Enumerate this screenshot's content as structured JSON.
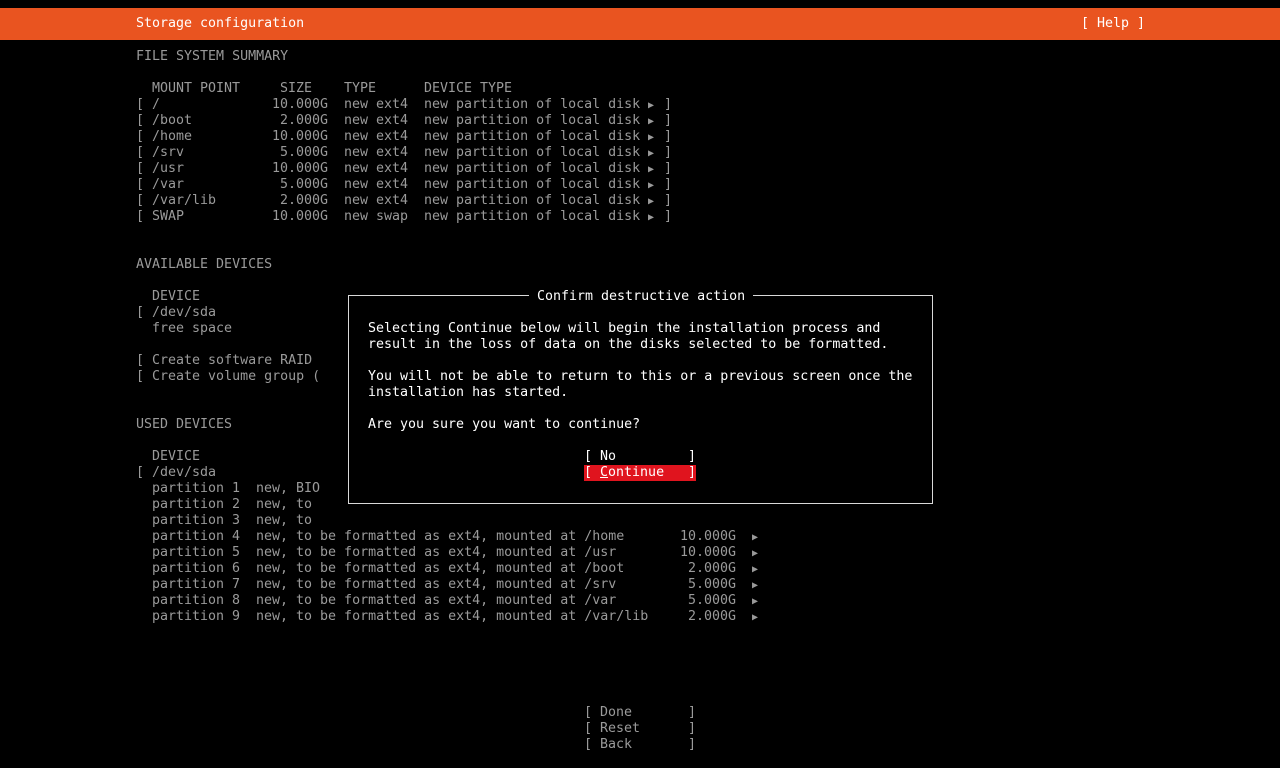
{
  "header": {
    "title": "Storage configuration",
    "help_label": "[ Help ]"
  },
  "summary": {
    "heading": "FILE SYSTEM SUMMARY",
    "columns": {
      "mount": "MOUNT POINT",
      "size": "SIZE",
      "type": "TYPE",
      "device_type": "DEVICE TYPE"
    },
    "rows": [
      {
        "mount": "/",
        "size": "10.000G",
        "type": "new ext4",
        "device_type": "new partition of local disk"
      },
      {
        "mount": "/boot",
        "size": "2.000G",
        "type": "new ext4",
        "device_type": "new partition of local disk"
      },
      {
        "mount": "/home",
        "size": "10.000G",
        "type": "new ext4",
        "device_type": "new partition of local disk"
      },
      {
        "mount": "/srv",
        "size": "5.000G",
        "type": "new ext4",
        "device_type": "new partition of local disk"
      },
      {
        "mount": "/usr",
        "size": "10.000G",
        "type": "new ext4",
        "device_type": "new partition of local disk"
      },
      {
        "mount": "/var",
        "size": "5.000G",
        "type": "new ext4",
        "device_type": "new partition of local disk"
      },
      {
        "mount": "/var/lib",
        "size": "2.000G",
        "type": "new ext4",
        "device_type": "new partition of local disk"
      },
      {
        "mount": "SWAP",
        "size": "10.000G",
        "type": "new swap",
        "device_type": "new partition of local disk"
      }
    ]
  },
  "available": {
    "heading": "AVAILABLE DEVICES",
    "device_col": "DEVICE",
    "device": "/dev/sda",
    "free_space": "free space",
    "create_raid": "Create software RAID",
    "create_vg": "Create volume group ("
  },
  "used": {
    "heading": "USED DEVICES",
    "device_col": "DEVICE",
    "device": "/dev/sda",
    "partitions": [
      {
        "name": "partition 1",
        "desc": "new, BIO",
        "size": ""
      },
      {
        "name": "partition 2",
        "desc": "new, to",
        "size": ""
      },
      {
        "name": "partition 3",
        "desc": "new, to",
        "size": ""
      },
      {
        "name": "partition 4",
        "desc": "new, to be formatted as ext4, mounted at /home",
        "size": "10.000G"
      },
      {
        "name": "partition 5",
        "desc": "new, to be formatted as ext4, mounted at /usr",
        "size": "10.000G"
      },
      {
        "name": "partition 6",
        "desc": "new, to be formatted as ext4, mounted at /boot",
        "size": "2.000G"
      },
      {
        "name": "partition 7",
        "desc": "new, to be formatted as ext4, mounted at /srv",
        "size": "5.000G"
      },
      {
        "name": "partition 8",
        "desc": "new, to be formatted as ext4, mounted at /var",
        "size": "5.000G"
      },
      {
        "name": "partition 9",
        "desc": "new, to be formatted as ext4, mounted at /var/lib",
        "size": "2.000G"
      }
    ]
  },
  "dialog": {
    "title": "Confirm destructive action",
    "para1_line1": "Selecting Continue below will begin the installation process and",
    "para1_line2": "result in the loss of data on the disks selected to be formatted.",
    "para2_line1": "You will not be able to return to this or a previous screen once the",
    "para2_line2": "installation has started.",
    "question": "Are you sure you want to continue?",
    "no_label": "No",
    "continue_first": "C",
    "continue_rest": "ontinue"
  },
  "footer": {
    "done": "Done",
    "reset": "Reset",
    "back": "Back"
  },
  "colors": {
    "accent": "#e95420",
    "selected": "#e0141e"
  }
}
